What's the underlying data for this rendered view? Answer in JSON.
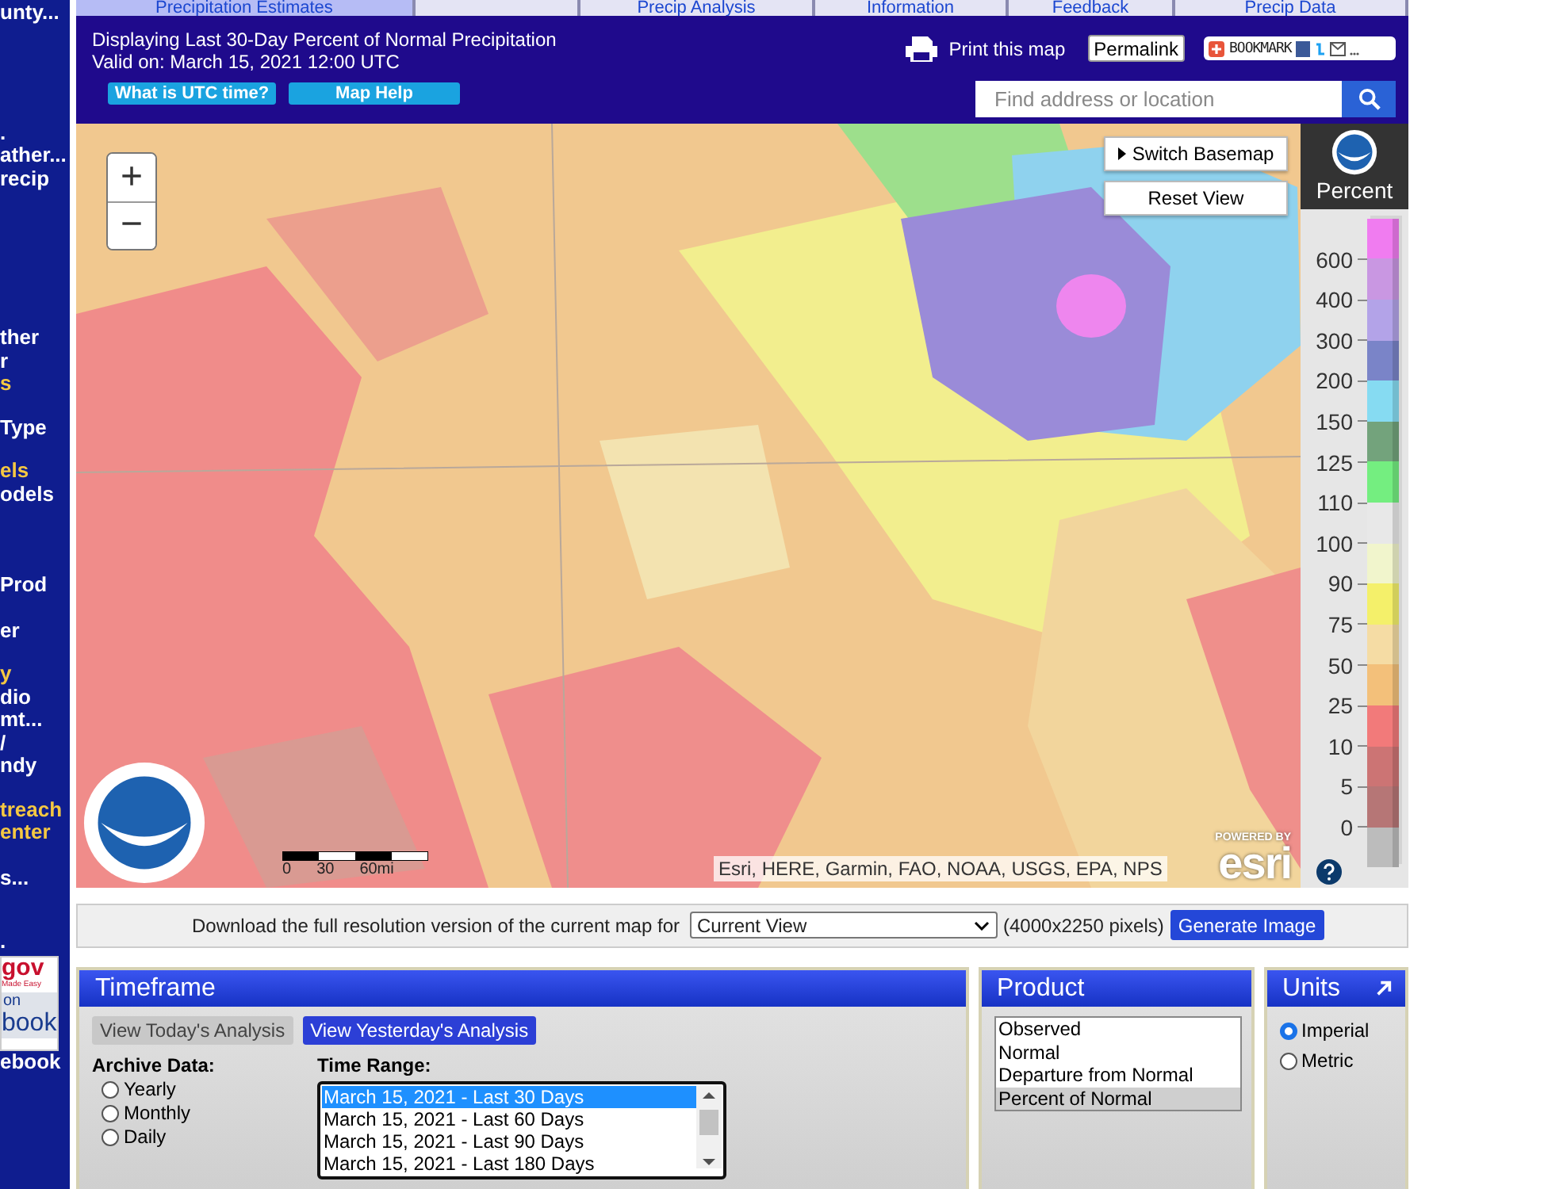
{
  "sidebar": {
    "groups": [
      {
        "lines": [
          {
            "text": "unty...",
            "color": "#ffffff"
          }
        ]
      },
      {
        "lines": [
          {
            "text": ".",
            "color": "#ffffff"
          },
          {
            "text": "ather...",
            "color": "#ffffff"
          },
          {
            "text": "recip",
            "color": "#ffffff"
          }
        ]
      },
      {
        "lines": [
          {
            "text": "ther",
            "color": "#ffffff"
          },
          {
            "text": "r",
            "color": "#ffffff"
          },
          {
            "text": "s",
            "color": "#f5c842"
          }
        ]
      },
      {
        "lines": [
          {
            "text": "Type",
            "color": "#ffffff"
          }
        ]
      },
      {
        "lines": [
          {
            "text": "els",
            "color": "#f5c842"
          },
          {
            "text": "odels",
            "color": "#ffffff"
          }
        ]
      },
      {
        "lines": [
          {
            "text": "Prod",
            "color": "#ffffff"
          }
        ]
      },
      {
        "lines": [
          {
            "text": "er",
            "color": "#ffffff"
          }
        ]
      },
      {
        "lines": [
          {
            "text": "y",
            "color": "#f5c842"
          },
          {
            "text": "dio",
            "color": "#ffffff"
          },
          {
            "text": "mt...",
            "color": "#ffffff"
          },
          {
            "text": "/",
            "color": "#ffffff"
          },
          {
            "text": "ndy",
            "color": "#ffffff"
          }
        ]
      },
      {
        "lines": [
          {
            "text": "treach",
            "color": "#f5c842"
          },
          {
            "text": "enter",
            "color": "#f5c842"
          }
        ]
      },
      {
        "lines": [
          {
            "text": "s...",
            "color": "#ffffff"
          }
        ]
      },
      {
        "lines": [
          {
            "text": ".",
            "color": "#ffffff"
          }
        ]
      }
    ],
    "banner": {
      "brand": "gov",
      "tagline": "Made Easy",
      "line1": "on",
      "line2": "book"
    },
    "footer_link": "ebook"
  },
  "tabs": [
    {
      "label": "Precipitation Estimates",
      "selected": true
    },
    {
      "selected": false
    },
    {
      "label": "Precip Analysis",
      "selected": false
    },
    {
      "label": "Information",
      "selected": false
    },
    {
      "label": "Feedback",
      "selected": false
    },
    {
      "label": "Precip Data",
      "selected": false
    }
  ],
  "header": {
    "title": "Displaying Last 30-Day Percent of Normal Precipitation",
    "valid": "Valid on: March 15, 2021 12:00 UTC",
    "buttons": [
      "What is UTC time?",
      "Map Help"
    ],
    "print": "Print this map",
    "permalink": "Permalink",
    "bookmark": "BOOKMARK",
    "search": {
      "placeholder": "Find address or location"
    }
  },
  "map": {
    "zoom_in": "+",
    "zoom_out": "−",
    "switch_basemap": "Switch Basemap",
    "reset_view": "Reset View",
    "scale": [
      "0",
      "30",
      "60mi"
    ],
    "attribution": "Esri, HERE, Garmin, FAO, NOAA, USGS, EPA, NPS",
    "powered_by": "POWERED BY",
    "esri": "esri"
  },
  "legend": {
    "title": "Percent",
    "labels": [
      "600",
      "400",
      "300",
      "200",
      "150",
      "125",
      "110",
      "100",
      "90",
      "75",
      "50",
      "25",
      "10",
      "5",
      "0"
    ],
    "bands": [
      {
        "color": "#f07cf0"
      },
      {
        "color": "#c997e2"
      },
      {
        "color": "#b3a3e8"
      },
      {
        "color": "#7a84c8"
      },
      {
        "color": "#86dbf2"
      },
      {
        "color": "#73a37c"
      },
      {
        "color": "#74ee80"
      },
      {
        "color": "#e8e8e8"
      },
      {
        "color": "#f1f5cc"
      },
      {
        "color": "#f4f06a"
      },
      {
        "color": "#f5dca4"
      },
      {
        "color": "#f3c07a"
      },
      {
        "color": "#f27a7a"
      },
      {
        "color": "#cc7474"
      },
      {
        "color": "#b67676"
      },
      {
        "color": "#bcbcbc"
      }
    ]
  },
  "download": {
    "text": "Download the full resolution version of the current map for",
    "select": "Current View",
    "size": "(4000x2250 pixels)",
    "button": "Generate Image"
  },
  "timeframe": {
    "title": "Timeframe",
    "buttons": [
      {
        "label": "View Today's Analysis",
        "selected": true
      },
      {
        "label": "View Yesterday's Analysis",
        "selected": false
      }
    ],
    "archive_label": "Archive Data:",
    "archive": [
      {
        "label": "Yearly",
        "selected": false
      },
      {
        "label": "Monthly",
        "selected": false
      },
      {
        "label": "Daily",
        "selected": false
      }
    ],
    "range_label": "Time Range:",
    "ranges": [
      {
        "label": "March 15, 2021 - Last 30 Days",
        "selected": true
      },
      {
        "label": "March 15, 2021 - Last 60 Days",
        "selected": false
      },
      {
        "label": "March 15, 2021 - Last 90 Days",
        "selected": false
      },
      {
        "label": "March 15, 2021 - Last 180 Days",
        "selected": false
      }
    ]
  },
  "product": {
    "title": "Product",
    "options": [
      {
        "label": "Observed",
        "selected": false
      },
      {
        "label": "Normal",
        "selected": false
      },
      {
        "label": "Departure from Normal",
        "selected": false
      },
      {
        "label": "Percent of Normal",
        "selected": true
      }
    ]
  },
  "units": {
    "title": "Units",
    "options": [
      {
        "label": "Imperial",
        "selected": true
      },
      {
        "label": "Metric",
        "selected": false
      }
    ]
  }
}
